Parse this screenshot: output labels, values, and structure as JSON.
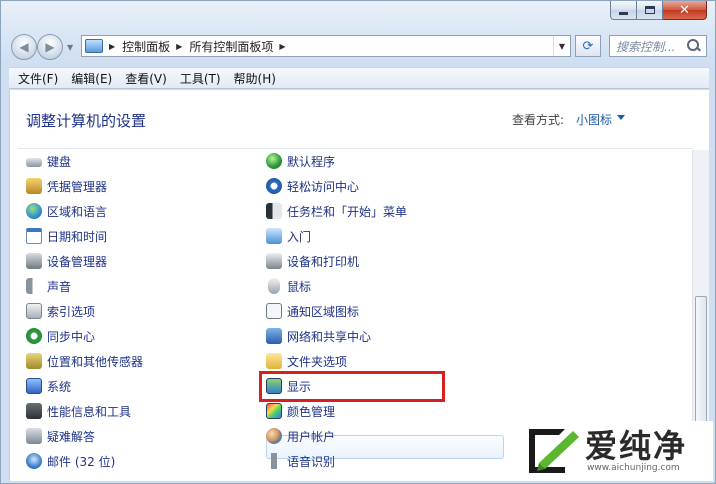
{
  "window": {
    "caption_buttons": [
      "minimize",
      "maximize",
      "close"
    ],
    "close_glyph": "✕"
  },
  "navigation": {
    "breadcrumb": [
      "控制面板",
      "所有控制面板项"
    ],
    "search_placeholder": "搜索控制..."
  },
  "menu": [
    "文件(F)",
    "编辑(E)",
    "查看(V)",
    "工具(T)",
    "帮助(H)"
  ],
  "content": {
    "title": "调整计算机的设置",
    "view_label": "查看方式:",
    "view_value": "小图标"
  },
  "items": {
    "col1": [
      {
        "label": "键盘",
        "icon": "keyboard-icon"
      },
      {
        "label": "凭据管理器",
        "icon": "credential-manager-icon"
      },
      {
        "label": "区域和语言",
        "icon": "globe-icon"
      },
      {
        "label": "日期和时间",
        "icon": "calendar-icon"
      },
      {
        "label": "设备管理器",
        "icon": "device-manager-icon"
      },
      {
        "label": "声音",
        "icon": "speaker-icon"
      },
      {
        "label": "索引选项",
        "icon": "index-icon"
      },
      {
        "label": "同步中心",
        "icon": "sync-icon"
      },
      {
        "label": "位置和其他传感器",
        "icon": "sensor-icon"
      },
      {
        "label": "系统",
        "icon": "system-icon"
      },
      {
        "label": "性能信息和工具",
        "icon": "performance-icon"
      },
      {
        "label": "疑难解答",
        "icon": "troubleshoot-icon"
      },
      {
        "label": "邮件 (32 位)",
        "icon": "mail-icon"
      }
    ],
    "col2": [
      {
        "label": "默认程序",
        "icon": "default-programs-icon"
      },
      {
        "label": "轻松访问中心",
        "icon": "ease-of-access-icon"
      },
      {
        "label": "任务栏和「开始」菜单",
        "icon": "taskbar-icon"
      },
      {
        "label": "入门",
        "icon": "getting-started-icon"
      },
      {
        "label": "设备和打印机",
        "icon": "printer-icon"
      },
      {
        "label": "鼠标",
        "icon": "mouse-icon"
      },
      {
        "label": "通知区域图标",
        "icon": "notification-icon"
      },
      {
        "label": "网络和共享中心",
        "icon": "network-icon"
      },
      {
        "label": "文件夹选项",
        "icon": "folder-icon"
      },
      {
        "label": "显示",
        "icon": "display-icon"
      },
      {
        "label": "颜色管理",
        "icon": "color-management-icon"
      },
      {
        "label": "用户帐户",
        "icon": "user-accounts-icon"
      },
      {
        "label": "语音识别",
        "icon": "microphone-icon"
      }
    ]
  },
  "watermark": {
    "title": "爱纯净",
    "url": "www.aichunjing.com"
  }
}
